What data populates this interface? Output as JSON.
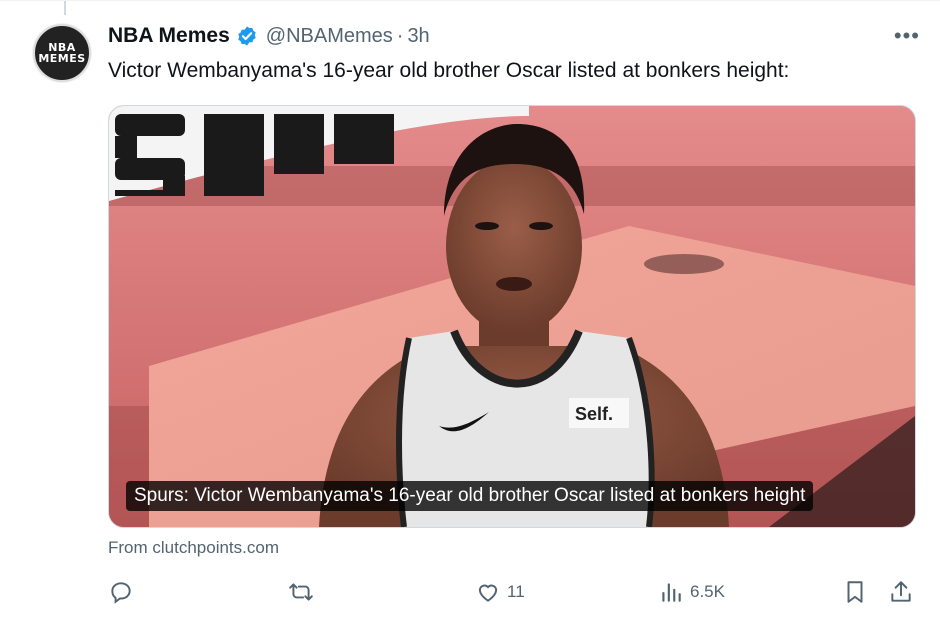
{
  "tweet": {
    "author_name": "NBA Memes",
    "handle": "@NBAMemes",
    "separator": "·",
    "time": "3h",
    "text": "Victor Wembanyama's 16-year old brother Oscar listed at bonkers height:",
    "avatar_text_line1": "NBA",
    "avatar_text_line2": "MEMES"
  },
  "media": {
    "caption": "Spurs: Victor Wembanyama's 16-year old brother Oscar listed at bonkers height",
    "jersey_text": "Self.",
    "source": "From clutchpoints.com"
  },
  "actions": {
    "reply_icon": "reply-icon",
    "retweet_icon": "retweet-icon",
    "like_icon": "heart-icon",
    "like_count": "11",
    "views_icon": "views-icon",
    "views_count": "6.5K",
    "bookmark_icon": "bookmark-icon",
    "share_icon": "share-icon"
  },
  "colors": {
    "verified": "#1d9bf0",
    "secondary_text": "#536471",
    "primary_text": "#0f1419"
  }
}
